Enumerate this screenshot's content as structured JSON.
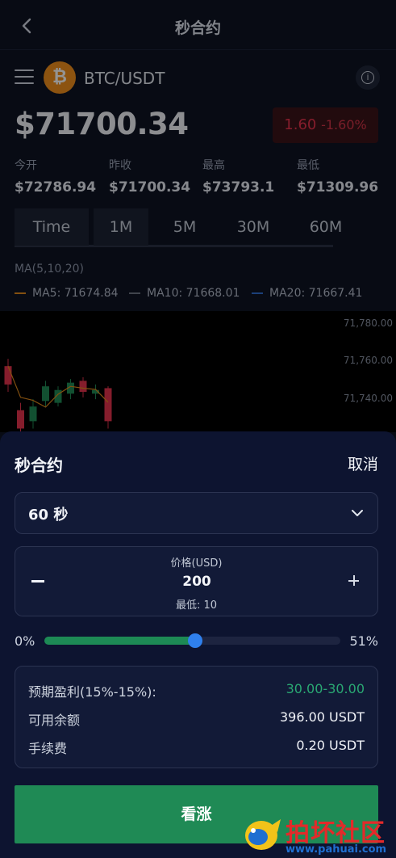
{
  "nav": {
    "title": "秒合约"
  },
  "pair": {
    "name": "BTC/USDT",
    "coin_symbol": "₿",
    "info_glyph": "i"
  },
  "price": {
    "value": "$71700.34",
    "change": "1.60",
    "change_pct": "-1.60%"
  },
  "stats": [
    {
      "label": "今开",
      "value": "$72786.94"
    },
    {
      "label": "昨收",
      "value": "$71700.34"
    },
    {
      "label": "最高",
      "value": "$73793.1"
    },
    {
      "label": "最低",
      "value": "$71309.96"
    }
  ],
  "tabs": [
    "Time",
    "1M",
    "5M",
    "30M",
    "60M"
  ],
  "active_tab": "1M",
  "ma": {
    "title": "MA(5,10,20)",
    "items": [
      {
        "label": "MA5: 71674.84",
        "color": "#e28b1c"
      },
      {
        "label": "MA10: 71668.01",
        "color": "#6f7583"
      },
      {
        "label": "MA20: 71667.41",
        "color": "#2f6fd1"
      }
    ]
  },
  "chart_data": {
    "type": "candlestick",
    "y_ticks": [
      "71,780.00",
      "71,760.00",
      "71,740.00"
    ],
    "candles": [
      {
        "open": 71742,
        "close": 71752,
        "high": 71756,
        "low": 71738,
        "up": false
      },
      {
        "open": 71728,
        "close": 71718,
        "high": 71732,
        "low": 71714,
        "up": false
      },
      {
        "open": 71722,
        "close": 71730,
        "high": 71734,
        "low": 71718,
        "up": true
      },
      {
        "open": 71733,
        "close": 71741,
        "high": 71744,
        "low": 71730,
        "up": true
      },
      {
        "open": 71732,
        "close": 71739,
        "high": 71741,
        "low": 71730,
        "up": true
      },
      {
        "open": 71737,
        "close": 71743,
        "high": 71745,
        "low": 71734,
        "up": true
      },
      {
        "open": 71744,
        "close": 71738,
        "high": 71746,
        "low": 71735,
        "up": false
      },
      {
        "open": 71739,
        "close": 71737,
        "high": 71742,
        "low": 71734,
        "up": true
      },
      {
        "open": 71740,
        "close": 71722,
        "high": 71741,
        "low": 71718,
        "up": false
      }
    ],
    "ylim": [
      71716,
      71782
    ]
  },
  "sheet": {
    "title": "秒合约",
    "cancel_label": "取消",
    "duration": "60 秒",
    "amount_label": "价格(USD)",
    "amount_value": "200",
    "amount_min": "最低: 10",
    "slider": {
      "min_label": "0%",
      "max_label": "51%",
      "value_fraction": 0.51
    },
    "summary": [
      {
        "key": "预期盈利(15%-15%):",
        "value": "30.00-30.00",
        "accent": true
      },
      {
        "key": "可用余额",
        "value": "396.00 USDT",
        "accent": false
      },
      {
        "key": "手续费",
        "value": "0.20 USDT",
        "accent": false
      }
    ],
    "action_label": "看涨"
  },
  "watermark": {
    "text": "拍坏社区",
    "url": "www.pahuai.com"
  },
  "colors": {
    "up": "#1f8a55",
    "down": "#e6334c",
    "accent_blue": "#2f80ed"
  }
}
